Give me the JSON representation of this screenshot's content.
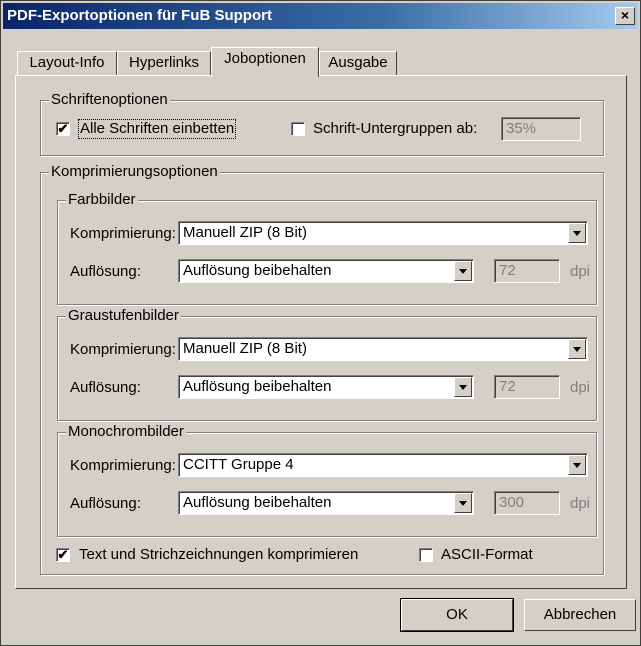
{
  "window": {
    "title": "PDF-Exportoptionen für FuB Support",
    "close_glyph": "×"
  },
  "tabs": [
    {
      "label": "Layout-Info"
    },
    {
      "label": "Hyperlinks"
    },
    {
      "label": "Joboptionen"
    },
    {
      "label": "Ausgabe"
    }
  ],
  "fonts_group": {
    "legend": "Schriftenoptionen",
    "embed_all": {
      "label": "Alle Schriften einbetten",
      "checked": true
    },
    "subset": {
      "label": "Schrift-Untergruppen ab:",
      "checked": false,
      "value": "35%"
    }
  },
  "compression_group": {
    "legend": "Komprimierungsoptionen",
    "color": {
      "legend": "Farbbilder",
      "compression_label": "Komprimierung:",
      "compression_value": "Manuell ZIP (8 Bit)",
      "resolution_label": "Auflösung:",
      "resolution_value": "Auflösung beibehalten",
      "dpi_value": "72",
      "dpi_unit": "dpi"
    },
    "gray": {
      "legend": "Graustufenbilder",
      "compression_label": "Komprimierung:",
      "compression_value": "Manuell ZIP (8 Bit)",
      "resolution_label": "Auflösung:",
      "resolution_value": "Auflösung beibehalten",
      "dpi_value": "72",
      "dpi_unit": "dpi"
    },
    "mono": {
      "legend": "Monochrombilder",
      "compression_label": "Komprimierung:",
      "compression_value": "CCITT Gruppe 4",
      "resolution_label": "Auflösung:",
      "resolution_value": "Auflösung beibehalten",
      "dpi_value": "300",
      "dpi_unit": "dpi"
    },
    "compress_text": {
      "label": "Text und Strichzeichnungen komprimieren",
      "checked": true
    },
    "ascii": {
      "label": "ASCII-Format",
      "checked": false
    }
  },
  "buttons": {
    "ok": "OK",
    "cancel": "Abbrechen"
  },
  "check_glyph": "✔"
}
